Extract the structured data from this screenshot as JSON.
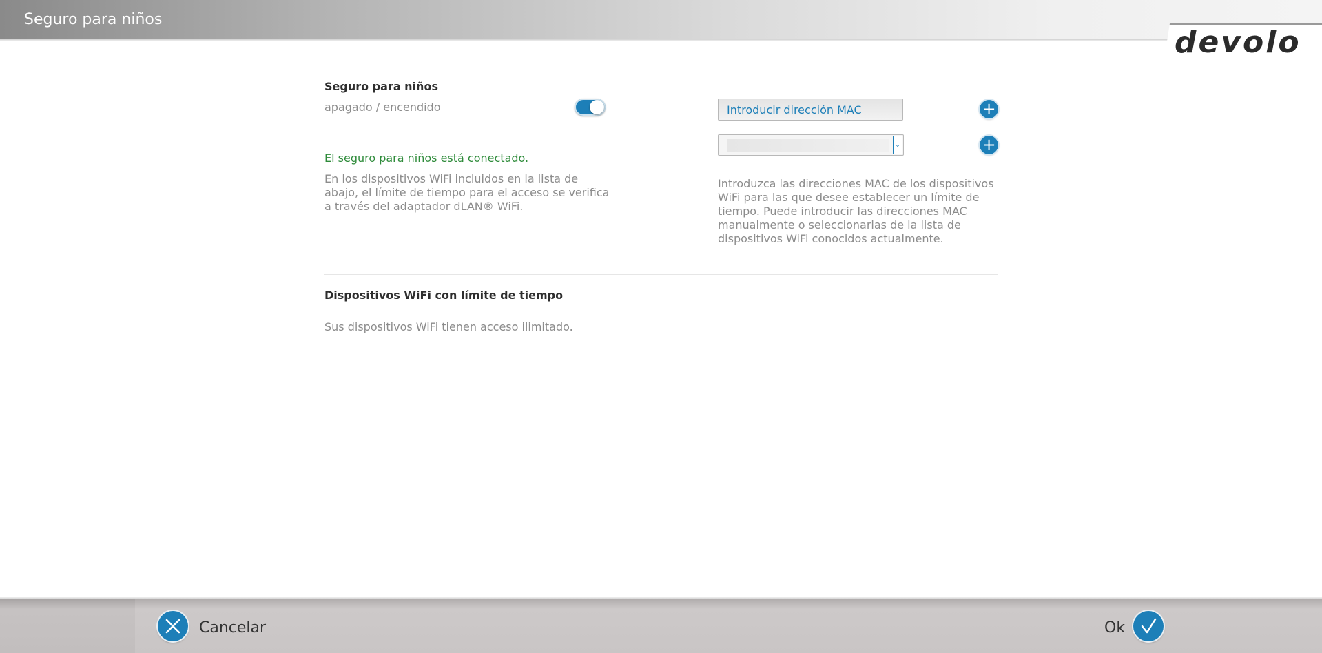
{
  "header": {
    "title": "Seguro para niños",
    "logo_text": "devolo"
  },
  "child_lock": {
    "title": "Seguro para niños",
    "toggle_label": "apagado / encendido",
    "toggle_state": "on",
    "status": "El seguro para niños está conectado.",
    "description": "En los dispositivos WiFi incluidos en la lista de abajo, el límite de tiempo para el acceso se verifica a través del adaptador dLAN® WiFi."
  },
  "mac": {
    "placeholder": "Introducir dirección MAC",
    "select_value": "",
    "add_icon": "plus-icon",
    "description": "Introduzca las direcciones MAC de los dispositivos WiFi para las que desee establecer un límite de tiempo. Puede introducir las direcciones MAC manualmente o seleccionarlas de la lista de dispositivos WiFi conocidos actualmente."
  },
  "devices": {
    "title": "Dispositivos WiFi con límite de tiempo",
    "empty_text": "Sus dispositivos WiFi tienen acceso ilimitado."
  },
  "footer": {
    "cancel_label": "Cancelar",
    "ok_label": "Ok"
  },
  "colors": {
    "accent": "#1d7fb8",
    "status_green": "#2e8b3a"
  }
}
